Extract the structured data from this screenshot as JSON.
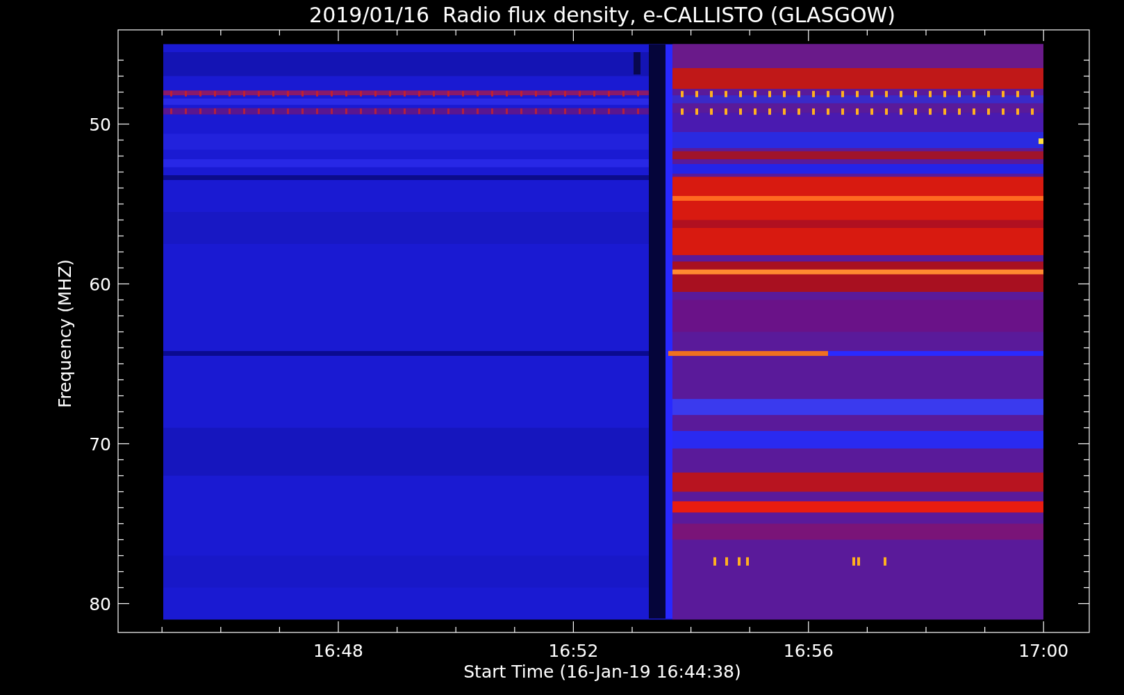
{
  "title": "2019/01/16  Radio flux density, e-CALLISTO (GLASGOW)",
  "y_axis": {
    "label": "Frequency (MHZ)",
    "ticks": [
      "50",
      "60",
      "70",
      "80"
    ]
  },
  "x_axis": {
    "label": "Start Time (16-Jan-19 16:44:38)",
    "ticks": [
      "16:48",
      "16:52",
      "16:56",
      "17:00"
    ]
  }
}
